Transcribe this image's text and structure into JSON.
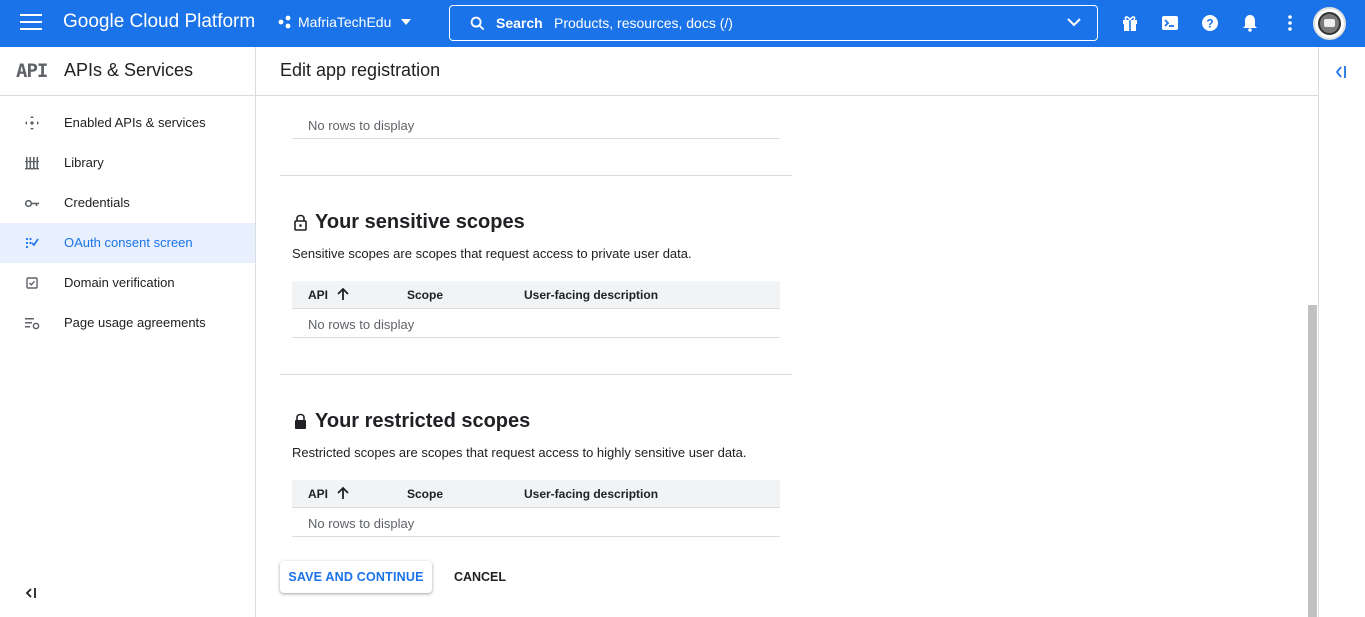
{
  "topbar": {
    "brand": "Google Cloud Platform",
    "project_name": "MafriaTechEdu",
    "search_label": "Search",
    "search_placeholder": "Products, resources, docs (/)"
  },
  "sidebar": {
    "logo": "API",
    "title": "APIs & Services",
    "items": [
      {
        "label": "Enabled APIs & services",
        "icon": "api-hub-icon"
      },
      {
        "label": "Library",
        "icon": "library-icon"
      },
      {
        "label": "Credentials",
        "icon": "key-icon"
      },
      {
        "label": "OAuth consent screen",
        "icon": "consent-icon",
        "active": true
      },
      {
        "label": "Domain verification",
        "icon": "checkbox-icon"
      },
      {
        "label": "Page usage agreements",
        "icon": "settings-list-icon"
      }
    ]
  },
  "main": {
    "page_title": "Edit app registration",
    "columns": {
      "api": "API",
      "scope": "Scope",
      "description": "User-facing description"
    },
    "empty_text": "No rows to display",
    "sensitive": {
      "title": "Your sensitive scopes",
      "description": "Sensitive scopes are scopes that request access to private user data."
    },
    "restricted": {
      "title": "Your restricted scopes",
      "description": "Restricted scopes are scopes that request access to highly sensitive user data."
    },
    "save_label": "SAVE AND CONTINUE",
    "cancel_label": "CANCEL"
  },
  "colors": {
    "brand_blue": "#1a73e8",
    "active_bg": "#e8f0fe",
    "header_bg": "#f1f3f4"
  }
}
